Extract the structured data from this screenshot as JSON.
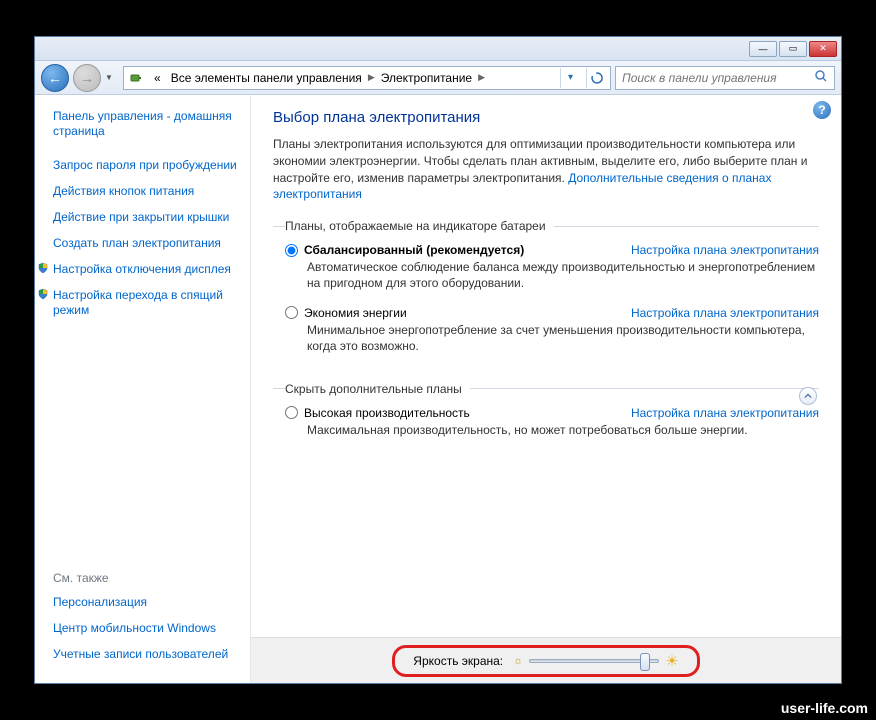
{
  "titlebar": {
    "min": "—",
    "max": "▭",
    "close": "✕"
  },
  "nav": {
    "back": "←",
    "fwd": "→"
  },
  "breadcrumb": {
    "prefix": "«",
    "item1": "Все элементы панели управления",
    "item2": "Электропитание"
  },
  "search": {
    "placeholder": "Поиск в панели управления"
  },
  "sidebar": {
    "home": "Панель управления - домашняя страница",
    "link1": "Запрос пароля при пробуждении",
    "link2": "Действия кнопок питания",
    "link3": "Действие при закрытии крышки",
    "link4": "Создать план электропитания",
    "link5": "Настройка отключения дисплея",
    "link6": "Настройка перехода в спящий режим",
    "see_also": "См. также",
    "rel1": "Персонализация",
    "rel2": "Центр мобильности Windows",
    "rel3": "Учетные записи пользователей"
  },
  "content": {
    "title": "Выбор плана электропитания",
    "desc_text": "Планы электропитания используются для оптимизации производительности компьютера или экономии электроэнергии. Чтобы сделать план активным, выделите его, либо выберите план и настройте его, изменив параметры электропитания. ",
    "desc_link": "Дополнительные сведения о планах электропитания",
    "legend1": "Планы, отображаемые на индикаторе батареи",
    "legend2": "Скрыть дополнительные планы",
    "settings_link": "Настройка плана электропитания",
    "plan1": {
      "name": "Сбалансированный (рекомендуется)",
      "desc": "Автоматическое соблюдение баланса между производительностью и энергопотреблением на пригодном для этого оборудовании."
    },
    "plan2": {
      "name": "Экономия энергии",
      "desc": "Минимальное энергопотребление за счет уменьшения производительности компьютера, когда это возможно."
    },
    "plan3": {
      "name": "Высокая производительность",
      "desc": "Максимальная производительность, но может потребоваться больше энергии."
    },
    "brightness_label": "Яркость экрана:"
  },
  "watermark": "user-life.com"
}
